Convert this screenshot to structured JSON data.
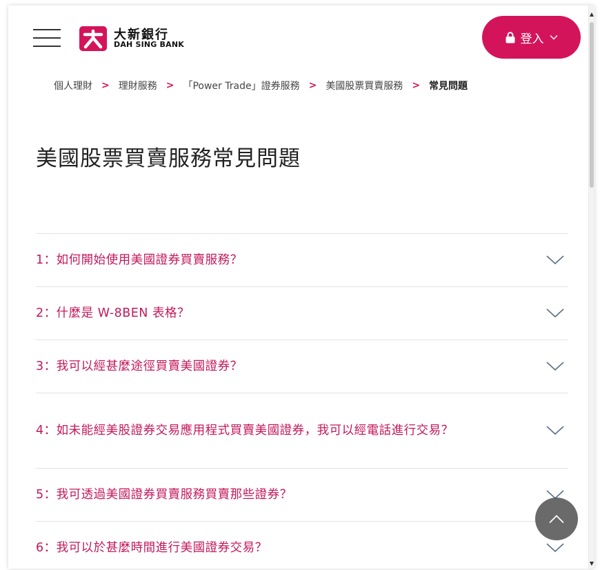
{
  "colors": {
    "brand": "#d4145a",
    "question_text": "#c2185b"
  },
  "header": {
    "logo_zh": "大新銀行",
    "logo_en": "DAH SING BANK",
    "login_label": "登入"
  },
  "breadcrumb": {
    "items": [
      {
        "label": "個人理財"
      },
      {
        "label": "理財服務"
      },
      {
        "label": "「Power Trade」證券服務"
      },
      {
        "label": "美國股票買賣服務"
      }
    ],
    "current": "常見問題"
  },
  "page_title": "美國股票買賣服務常見問題",
  "faq": {
    "items": [
      {
        "question": "1：如何開始使用美國證券買賣服務？"
      },
      {
        "question": "2：什麼是 W-8BEN 表格？"
      },
      {
        "question": "3：我可以經甚麼途徑買賣美國證券？"
      },
      {
        "question": "4：如未能經美股證券交易應用程式買賣美國證券，我可以經電話進行交易？"
      },
      {
        "question": "5：我可透過美國證券買賣服務買賣那些證券？"
      },
      {
        "question": "6：我可以於甚麼時間進行美國證券交易？"
      }
    ]
  },
  "icons": {
    "menu": "hamburger-icon",
    "lock": "lock-icon",
    "expand": "chevron-down-icon",
    "back_to_top": "chevron-up-icon"
  }
}
